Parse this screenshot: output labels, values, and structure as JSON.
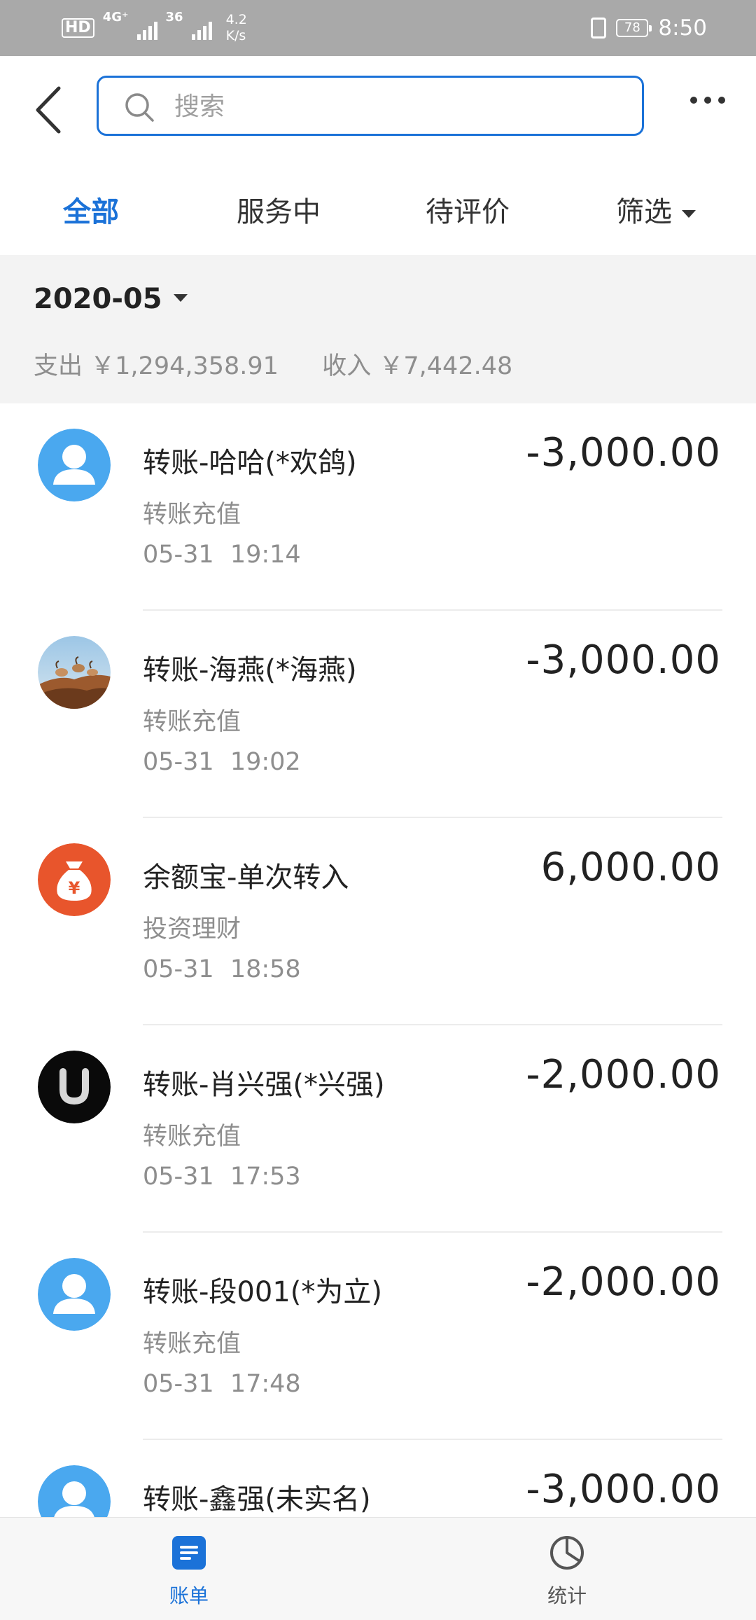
{
  "status_bar": {
    "hd": "HD",
    "sim1": "4G⁺",
    "sim2": "36",
    "speed_value": "4.2",
    "speed_unit": "K/s",
    "battery": "78",
    "time": "8:50"
  },
  "header": {
    "search_placeholder": "搜索"
  },
  "tabs": [
    {
      "label": "全部",
      "active": true
    },
    {
      "label": "服务中",
      "active": false
    },
    {
      "label": "待评价",
      "active": false
    },
    {
      "label": "筛选",
      "active": false
    }
  ],
  "month": {
    "title": "2020-05",
    "expense_label": "支出",
    "expense_value": "￥1,294,358.91",
    "income_label": "收入",
    "income_value": "￥7,442.48"
  },
  "transactions": [
    {
      "title": "转账-哈哈(*欢鸽)",
      "category": "转账充值",
      "time": "05-31 19:14",
      "amount": "-3,000.00",
      "avatar": "user-placeholder-icon"
    },
    {
      "title": "转账-海燕(*海燕)",
      "category": "转账充值",
      "time": "05-31 19:02",
      "amount": "-3,000.00",
      "avatar": "goats-photo"
    },
    {
      "title": "余额宝-单次转入",
      "category": "投资理财",
      "time": "05-31 18:58",
      "amount": "6,000.00",
      "avatar": "money-bag-icon"
    },
    {
      "title": "转账-肖兴强(*兴强)",
      "category": "转账充值",
      "time": "05-31 17:53",
      "amount": "-2,000.00",
      "avatar": "u-logo"
    },
    {
      "title": "转账-段001(*为立)",
      "category": "转账充值",
      "time": "05-31 17:48",
      "amount": "-2,000.00",
      "avatar": "user-placeholder-icon"
    },
    {
      "title": "转账-鑫强(未实名)",
      "category": "",
      "time": "",
      "amount": "-3,000.00",
      "avatar": "user-placeholder-icon"
    }
  ],
  "bottom_nav": [
    {
      "label": "账单",
      "icon": "bill-icon",
      "active": true
    },
    {
      "label": "统计",
      "icon": "pie-chart-icon",
      "active": false
    }
  ],
  "colors": {
    "accent": "#1b72d8",
    "user_avatar": "#4aa8ef",
    "money_bag": "#e8552c",
    "muted_text": "#8e8e8e"
  }
}
